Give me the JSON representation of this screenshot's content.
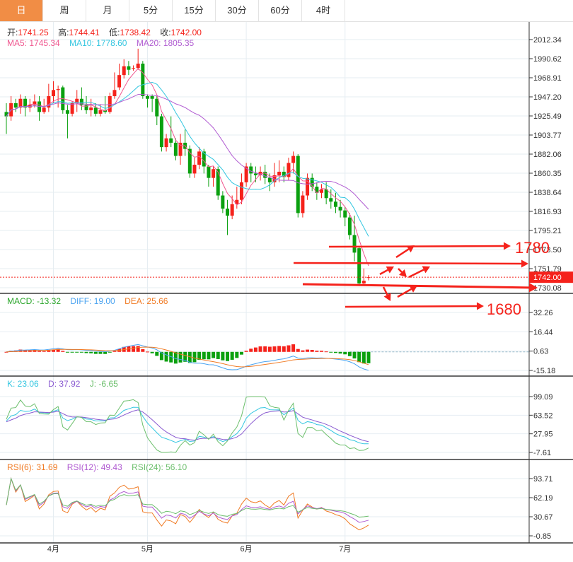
{
  "tabs": [
    {
      "label": "日",
      "active": true
    },
    {
      "label": "周"
    },
    {
      "label": "月"
    },
    {
      "label": "5分"
    },
    {
      "label": "15分"
    },
    {
      "label": "30分"
    },
    {
      "label": "60分"
    },
    {
      "label": "4时"
    }
  ],
  "ohlc_legend": {
    "open_label": "开:",
    "open": "1741.25",
    "high_label": "高:",
    "high": "1744.41",
    "low_label": "低:",
    "low": "1738.42",
    "close_label": "收:",
    "close": "1742.00"
  },
  "ma_legend": {
    "ma5": "MA5: 1745.34",
    "ma10": "MA10: 1778.60",
    "ma20": "MA20: 1805.35"
  },
  "macd_legend": {
    "macd": "MACD: -13.32",
    "diff": "DIFF: 19.00",
    "dea": "DEA: 25.66"
  },
  "kdj_legend": {
    "k": "K: 23.06",
    "d": "D: 37.92",
    "j": "J: -6.65"
  },
  "rsi_legend": {
    "rsi6": "RSI(6): 31.69",
    "rsi12": "RSI(12): 49.43",
    "rsi24": "RSI(24): 56.10"
  },
  "current_price": "1742.00",
  "annotations": {
    "target_up": "1780",
    "target_down": "1680"
  },
  "colors": {
    "up": "#f5221b",
    "down": "#0aa00f",
    "ma5": "#f0578f",
    "ma10": "#33c6e0",
    "ma20": "#b05bd1",
    "diff": "#4aa3f0",
    "dea": "#f07a23",
    "k": "#33c6e0",
    "d": "#8a5bd1",
    "j": "#6cbf6c",
    "rsi6": "#f07a23",
    "rsi12": "#b05bd1",
    "rsi24": "#6cbf6c",
    "active_tab": "#f18d45",
    "arrow": "#f5221b"
  },
  "chart_data": {
    "type": "candlestick",
    "x_labels": [
      {
        "index": 10,
        "label": "4月"
      },
      {
        "index": 30,
        "label": "5月"
      },
      {
        "index": 51,
        "label": "6月"
      },
      {
        "index": 72,
        "label": "7月"
      }
    ],
    "price_axis": {
      "ylim": [
        1730.08,
        2012.34
      ],
      "ticks": [
        "2012.34",
        "1990.62",
        "1968.91",
        "1947.20",
        "1925.49",
        "1903.77",
        "1882.06",
        "1860.35",
        "1838.64",
        "1816.93",
        "1795.21",
        "1773.50",
        "1751.79",
        "1730.08"
      ]
    },
    "macd_axis": {
      "ylim": [
        -15.18,
        32.26
      ],
      "ticks": [
        "32.26",
        "16.44",
        "0.63",
        "-15.18"
      ]
    },
    "kdj_axis": {
      "ylim": [
        -7.61,
        99.09
      ],
      "ticks": [
        "99.09",
        "63.52",
        "27.95",
        "-7.61"
      ]
    },
    "rsi_axis": {
      "ylim": [
        -0.85,
        93.71
      ],
      "ticks": [
        "93.71",
        "62.19",
        "30.67",
        "-0.85"
      ]
    },
    "candles": [
      [
        1930,
        1940,
        1905,
        1925
      ],
      [
        1925,
        1948,
        1920,
        1940
      ],
      [
        1940,
        1945,
        1930,
        1935
      ],
      [
        1935,
        1950,
        1928,
        1945
      ],
      [
        1945,
        1948,
        1925,
        1935
      ],
      [
        1935,
        1945,
        1930,
        1938
      ],
      [
        1938,
        1950,
        1935,
        1942
      ],
      [
        1942,
        1948,
        1920,
        1930
      ],
      [
        1930,
        1945,
        1928,
        1935
      ],
      [
        1935,
        1962,
        1930,
        1948
      ],
      [
        1948,
        1965,
        1940,
        1955
      ],
      [
        1955,
        1960,
        1935,
        1956
      ],
      [
        1958,
        1960,
        1928,
        1932
      ],
      [
        1932,
        1938,
        1900,
        1928
      ],
      [
        1928,
        1942,
        1925,
        1940
      ],
      [
        1940,
        1955,
        1930,
        1945
      ],
      [
        1945,
        1958,
        1932,
        1938
      ],
      [
        1938,
        1948,
        1928,
        1932
      ],
      [
        1932,
        1945,
        1925,
        1935
      ],
      [
        1935,
        1940,
        1925,
        1928
      ],
      [
        1928,
        1938,
        1925,
        1932
      ],
      [
        1932,
        1948,
        1928,
        1930
      ],
      [
        1930,
        1952,
        1928,
        1948
      ],
      [
        1948,
        1975,
        1945,
        1955
      ],
      [
        1958,
        1985,
        1955,
        1972
      ],
      [
        1972,
        1990,
        1968,
        1982
      ],
      [
        1982,
        1988,
        1972,
        1978
      ],
      [
        1980,
        1983,
        1977,
        1980
      ],
      [
        1980,
        2002,
        1978,
        1985
      ],
      [
        1985,
        1988,
        1945,
        1948
      ],
      [
        1948,
        1950,
        1935,
        1945
      ],
      [
        1948,
        1950,
        1930,
        1945
      ],
      [
        1945,
        1948,
        1915,
        1925
      ],
      [
        1925,
        1928,
        1885,
        1890
      ],
      [
        1890,
        1905,
        1885,
        1900
      ],
      [
        1900,
        1925,
        1890,
        1895
      ],
      [
        1895,
        1900,
        1875,
        1880
      ],
      [
        1880,
        1905,
        1870,
        1895
      ],
      [
        1895,
        1910,
        1880,
        1888
      ],
      [
        1888,
        1892,
        1855,
        1860
      ],
      [
        1860,
        1878,
        1855,
        1870
      ],
      [
        1870,
        1890,
        1865,
        1885
      ],
      [
        1885,
        1888,
        1860,
        1868
      ],
      [
        1868,
        1870,
        1845,
        1855
      ],
      [
        1855,
        1868,
        1845,
        1865
      ],
      [
        1865,
        1868,
        1830,
        1835
      ],
      [
        1835,
        1840,
        1815,
        1820
      ],
      [
        1820,
        1830,
        1790,
        1812
      ],
      [
        1812,
        1835,
        1808,
        1825
      ],
      [
        1825,
        1845,
        1820,
        1830
      ],
      [
        1830,
        1860,
        1825,
        1850
      ],
      [
        1850,
        1872,
        1845,
        1868
      ],
      [
        1868,
        1872,
        1850,
        1860
      ],
      [
        1860,
        1868,
        1850,
        1858
      ],
      [
        1858,
        1868,
        1852,
        1862
      ],
      [
        1862,
        1870,
        1848,
        1855
      ],
      [
        1855,
        1860,
        1840,
        1850
      ],
      [
        1850,
        1872,
        1845,
        1858
      ],
      [
        1858,
        1875,
        1850,
        1862
      ],
      [
        1862,
        1868,
        1850,
        1856
      ],
      [
        1856,
        1878,
        1852,
        1872
      ],
      [
        1872,
        1885,
        1860,
        1880
      ],
      [
        1880,
        1882,
        1810,
        1815
      ],
      [
        1815,
        1840,
        1810,
        1835
      ],
      [
        1835,
        1860,
        1830,
        1855
      ],
      [
        1855,
        1860,
        1840,
        1845
      ],
      [
        1845,
        1850,
        1830,
        1838
      ],
      [
        1838,
        1848,
        1832,
        1842
      ],
      [
        1842,
        1850,
        1825,
        1832
      ],
      [
        1832,
        1842,
        1820,
        1828
      ],
      [
        1828,
        1838,
        1815,
        1822
      ],
      [
        1822,
        1830,
        1810,
        1818
      ],
      [
        1818,
        1822,
        1800,
        1810
      ],
      [
        1810,
        1815,
        1785,
        1790
      ],
      [
        1790,
        1812,
        1760,
        1770
      ],
      [
        1775,
        1776,
        1732,
        1735
      ],
      [
        1735,
        1752,
        1734,
        1738
      ],
      [
        1741.25,
        1744.41,
        1738.42,
        1742.0
      ]
    ]
  }
}
